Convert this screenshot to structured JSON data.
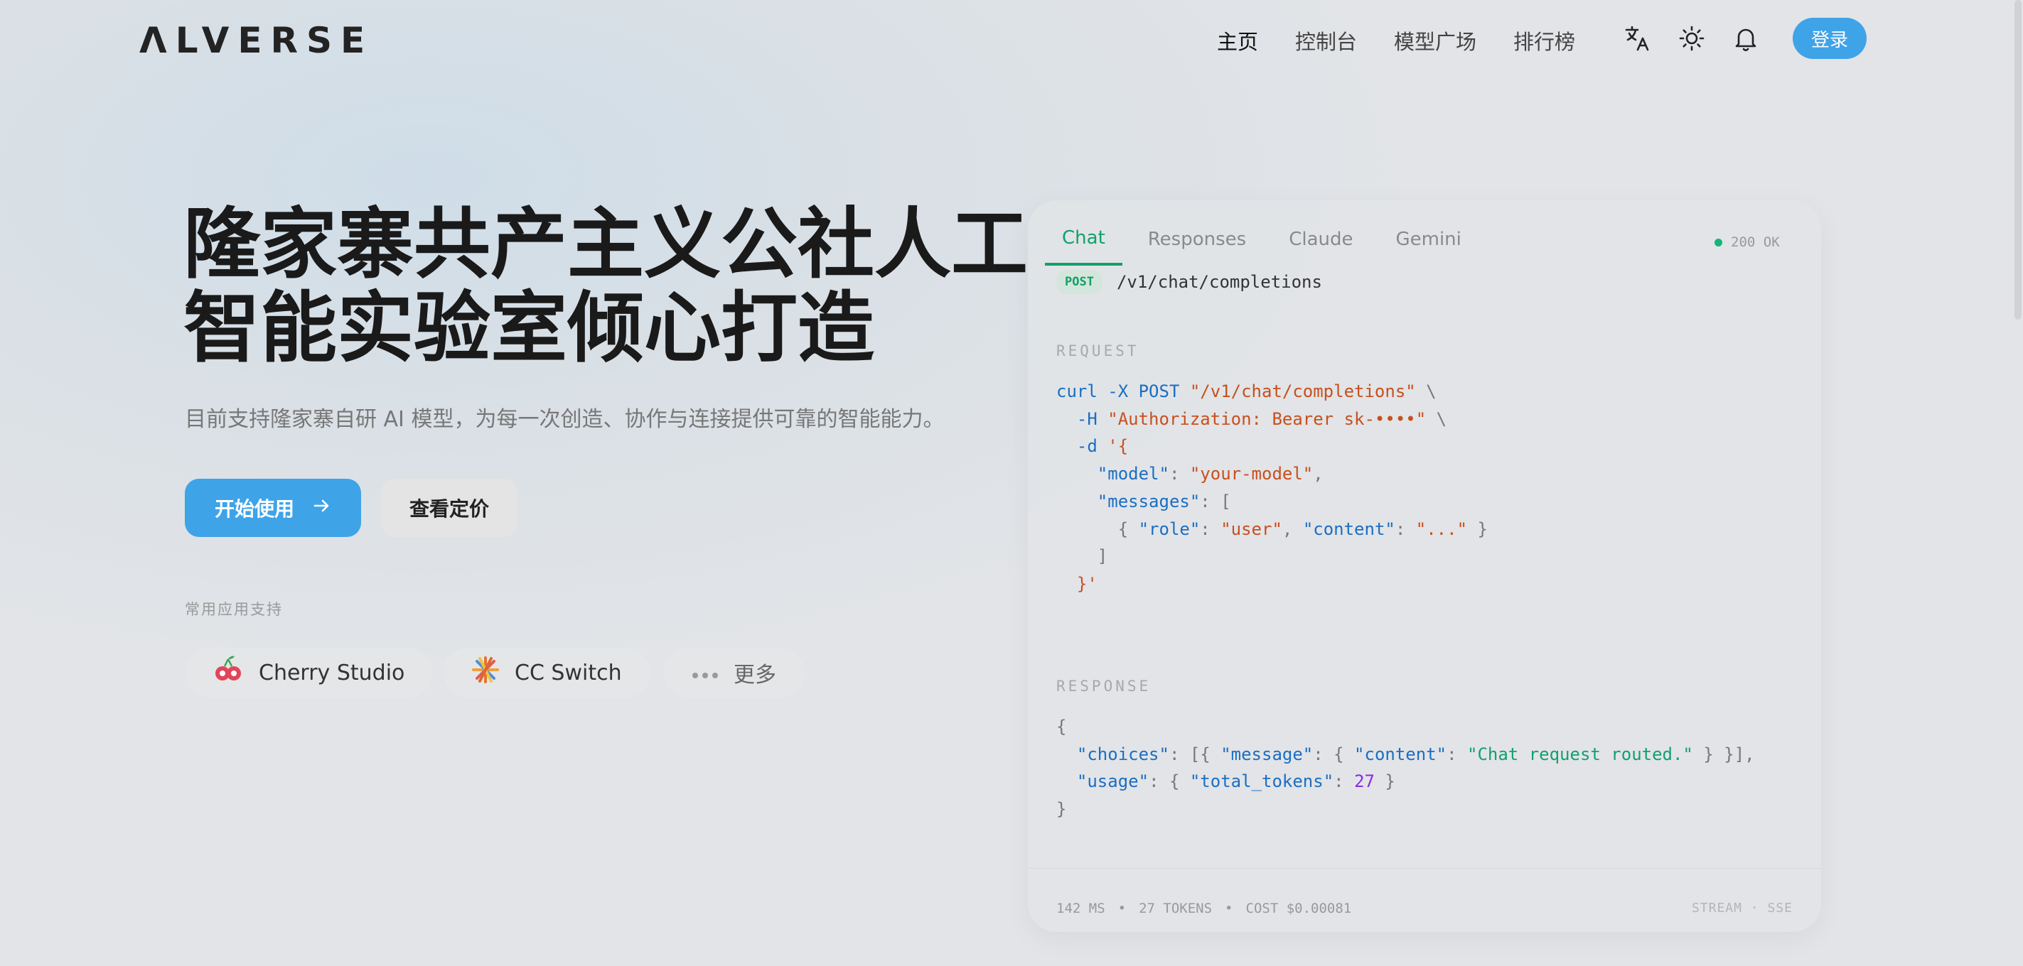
{
  "header": {
    "logo": "ΛLVERSE",
    "nav": [
      "主页",
      "控制台",
      "模型广场",
      "排行榜"
    ],
    "login": "登录",
    "icons": [
      "translate-icon",
      "sun-icon",
      "bell-icon"
    ]
  },
  "hero": {
    "title_line1": "隆家寨共产主义公社人工",
    "title_line2": "智能实验室倾心打造",
    "subtitle": "目前支持隆家寨自研 AI 模型，为每一次创造、协作与连接提供可靠的智能能力。",
    "start_button": "开始使用",
    "pricing_button": "查看定价",
    "apps_label": "常用应用支持",
    "apps": [
      "Cherry Studio",
      "CC Switch",
      "更多"
    ]
  },
  "code_panel": {
    "tabs": [
      "Chat",
      "Responses",
      "Claude",
      "Gemini"
    ],
    "active_tab": "Chat",
    "status": "200 OK",
    "method": "POST",
    "path": "/v1/chat/completions",
    "request_label": "REQUEST",
    "response_label": "RESPONSE",
    "footer": {
      "latency": "142 MS",
      "tokens": "27 TOKENS",
      "cost": "COST $0.00081",
      "mode": "STREAM · SSE"
    }
  },
  "colors": {
    "accent": "#3fa3e8",
    "active_tab": "#12a067",
    "status_dot": "#13b57a"
  }
}
